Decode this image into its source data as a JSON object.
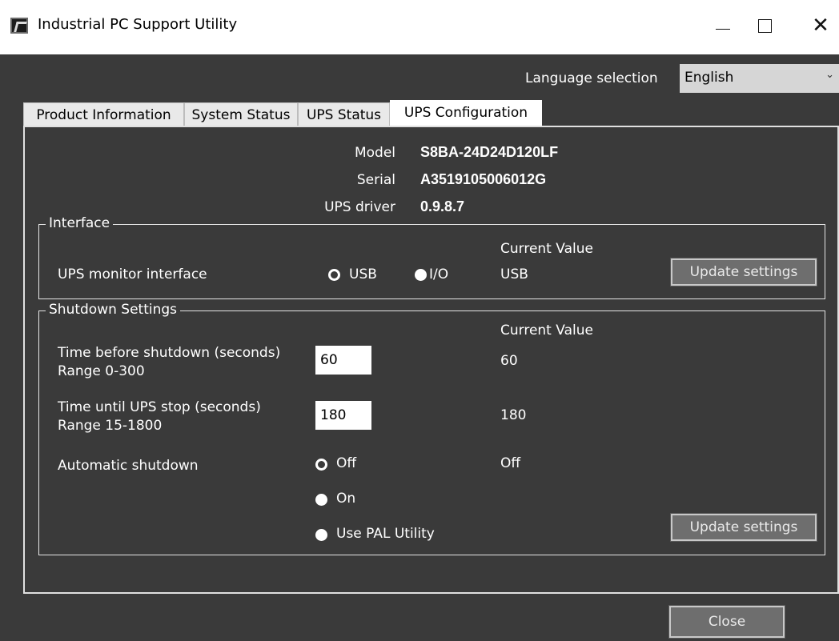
{
  "window": {
    "title": "Industrial PC Support Utility",
    "minimize": "—",
    "maximize": "□",
    "close": "✕"
  },
  "language": {
    "label": "Language selection",
    "selected": "English"
  },
  "tabs": [
    {
      "label": "Product Information",
      "active": false
    },
    {
      "label": "System Status",
      "active": false
    },
    {
      "label": "UPS Status",
      "active": false
    },
    {
      "label": "UPS Configuration",
      "active": true
    }
  ],
  "info": {
    "model_label": "Model",
    "model_value": "S8BA-24D24D120LF",
    "serial_label": "Serial",
    "serial_value": "A3519105006012G",
    "driver_label": "UPS driver",
    "driver_value": "0.9.8.7"
  },
  "interface": {
    "legend": "Interface",
    "current_value_header": "Current Value",
    "monitor_label": "UPS monitor interface",
    "option_usb": "USB",
    "option_io": "I/O",
    "current_value": "USB",
    "update_button": "Update settings"
  },
  "shutdown": {
    "legend": "Shutdown Settings",
    "current_value_header": "Current Value",
    "time_before_label": "Time before shutdown (seconds)",
    "time_before_range": "Range 0-300",
    "time_before_value": "60",
    "time_before_current": "60",
    "time_until_label": "Time until UPS stop (seconds)",
    "time_until_range": "Range 15-1800",
    "time_until_value": "180",
    "time_until_current": "180",
    "auto_label": "Automatic shutdown",
    "option_off": "Off",
    "option_on": "On",
    "option_pal": "Use PAL Utility",
    "auto_current": "Off",
    "update_button": "Update settings"
  },
  "footer": {
    "close_button": "Close"
  }
}
